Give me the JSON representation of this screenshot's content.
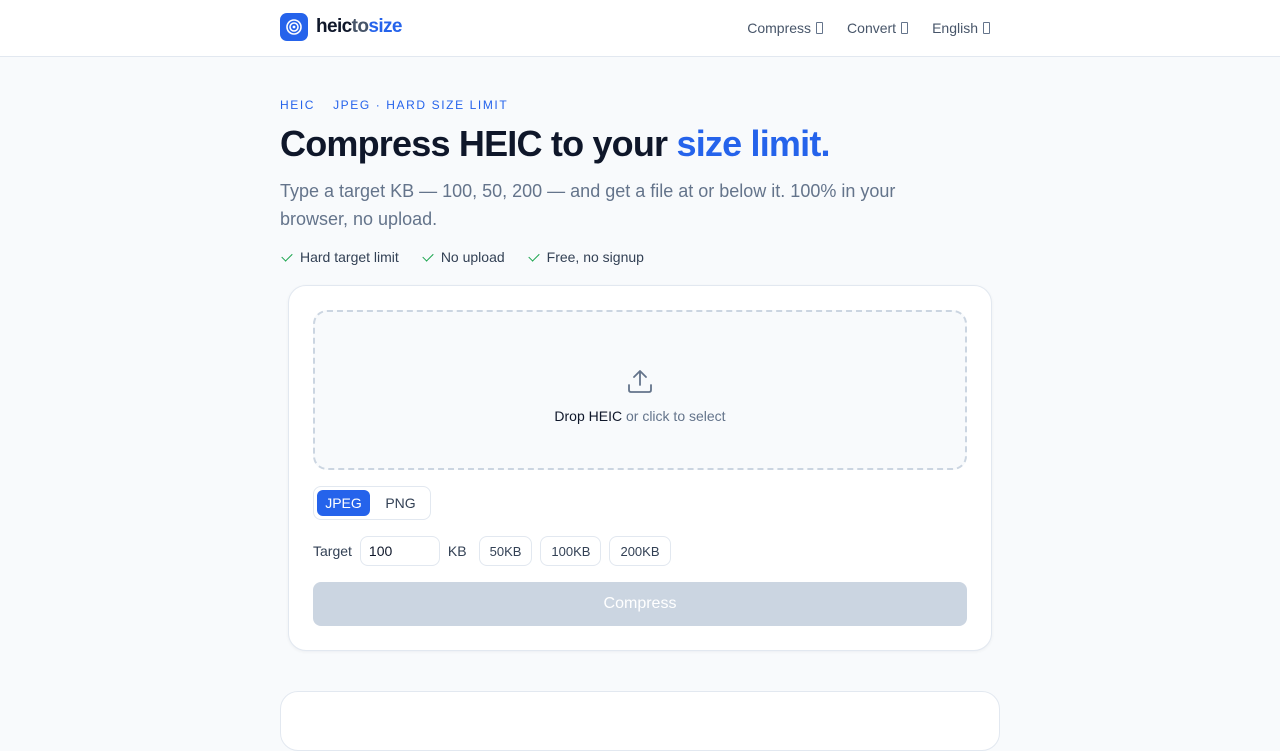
{
  "brand": {
    "name_part1": "heic",
    "name_part2": "to",
    "name_part3": "size",
    "accent_color": "#2563eb"
  },
  "nav": {
    "items": [
      {
        "label": "Compress",
        "icon": "chevron-down-icon"
      },
      {
        "label": "Convert",
        "icon": "chevron-down-icon"
      },
      {
        "label": "English",
        "icon": "chevron-down-icon"
      }
    ]
  },
  "hero": {
    "eyebrow": [
      "HEIC",
      "JPEG · HARD SIZE LIMIT"
    ],
    "title_main": "Compress HEIC to your ",
    "title_highlight": "size limit.",
    "subtitle": "Type a target KB — 100, 50, 200 — and get a file at or below it. 100% in your browser, no upload.",
    "perks": [
      "Hard target limit",
      "No upload",
      "Free, no signup"
    ]
  },
  "tool": {
    "dropzone": {
      "icon": "upload-icon",
      "strong": "Drop HEIC",
      "muted": " or click to select"
    },
    "formats": [
      {
        "label": "JPEG",
        "active": true
      },
      {
        "label": "PNG",
        "active": false
      }
    ],
    "target": {
      "label": "Target",
      "value": "100",
      "unit": "KB",
      "presets": [
        "50KB",
        "100KB",
        "200KB"
      ]
    },
    "compress_label": "Compress"
  }
}
